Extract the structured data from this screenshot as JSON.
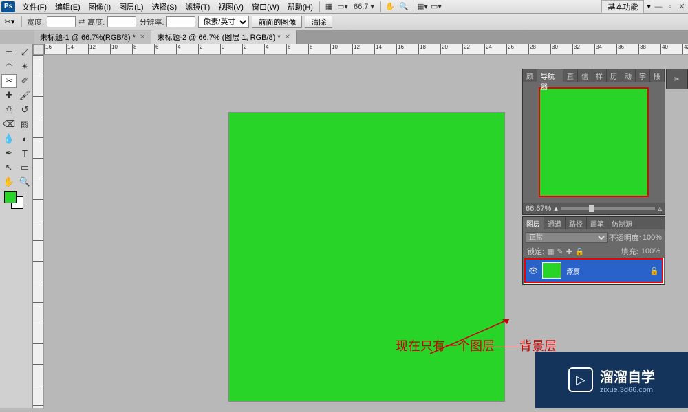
{
  "app": {
    "logo": "Ps"
  },
  "menu": {
    "items": [
      "文件(F)",
      "编辑(E)",
      "图像(I)",
      "图层(L)",
      "选择(S)",
      "滤镜(T)",
      "视图(V)",
      "窗口(W)",
      "帮助(H)"
    ],
    "zoom": "66.7",
    "workspace": "基本功能"
  },
  "options": {
    "tool_icon": "✂",
    "width_label": "宽度:",
    "height_label": "高度:",
    "swap_icon": "⇄",
    "resolution_label": "分辨率:",
    "unit": "像素/英寸",
    "front_image": "前面的图像",
    "clear": "清除"
  },
  "tabs": [
    {
      "label": "未标题-1 @ 66.7%(RGB/8) *",
      "active": false
    },
    {
      "label": "未标题-2 @ 66.7% (图层 1, RGB/8) *",
      "active": true
    }
  ],
  "tools": [
    "▭",
    "⤢",
    "�ច",
    "✎",
    "✂",
    "✐",
    "🖌",
    "⌫",
    "🖍",
    "⟳",
    "▨",
    "◐",
    "◆",
    "✏",
    "✒",
    "T",
    "↖",
    "▭",
    "✋",
    "🔍"
  ],
  "ruler_marks_h": [
    "16",
    "14",
    "12",
    "10",
    "8",
    "6",
    "4",
    "2",
    "0",
    "2",
    "4",
    "6",
    "8",
    "10",
    "12",
    "14",
    "16",
    "18",
    "20",
    "22",
    "24",
    "26",
    "28",
    "30",
    "32",
    "34",
    "36",
    "38",
    "40",
    "42"
  ],
  "navigator": {
    "tabs": [
      "颜",
      "导航器",
      "直",
      "信",
      "样",
      "历",
      "动",
      "字",
      "段"
    ],
    "zoom": "66.67%"
  },
  "layers": {
    "tabs": [
      "图层",
      "通道",
      "路径",
      "画笔",
      "仿制源"
    ],
    "mode": "正常",
    "opacity_label": "不透明度:",
    "opacity": "100%",
    "lock_label": "锁定:",
    "fill_label": "填充:",
    "fill": "100%",
    "layer_name": "背景"
  },
  "annotation": "现在只有一个图层——背景层",
  "watermark": {
    "title": "溜溜自学",
    "url": "zixue.3d66.com"
  }
}
